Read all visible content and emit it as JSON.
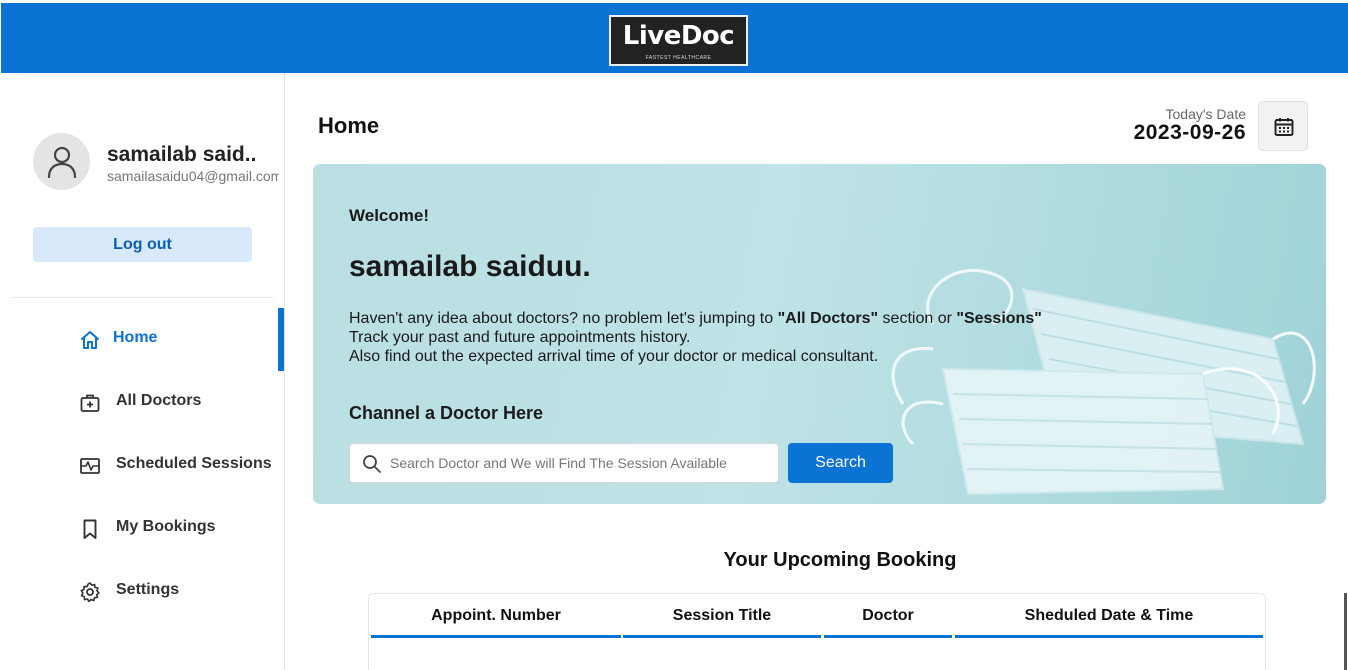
{
  "header": {
    "logo_text": "LiveDoc",
    "logo_tagline": "FASTEST HEALTHCARE"
  },
  "sidebar": {
    "user_name": "samailab said..",
    "user_email": "samailasaidu04@gmail.com",
    "logout_label": "Log out",
    "items": [
      {
        "label": "Home",
        "icon": "home-icon",
        "active": true
      },
      {
        "label": "All Doctors",
        "icon": "doctor-bag-icon",
        "active": false
      },
      {
        "label": "Scheduled Sessions",
        "icon": "pulse-schedule-icon",
        "active": false
      },
      {
        "label": "My Bookings",
        "icon": "bookmark-icon",
        "active": false
      },
      {
        "label": "Settings",
        "icon": "gear-icon",
        "active": false
      }
    ]
  },
  "main": {
    "title": "Home",
    "date_label": "Today's Date",
    "date_value": "2023-09-26",
    "banner": {
      "welcome": "Welcome!",
      "name": "samailab saiduu.",
      "line1_prefix": "Haven't any idea about doctors? no problem let's jumping to ",
      "line1_link1": "\"All Doctors\"",
      "line1_mid": " section or ",
      "line1_link2": "\"Sessions\"",
      "line2": "Track your past and future appointments history.",
      "line3": "Also find out the expected arrival time of your doctor or medical consultant.",
      "channel_title": "Channel a Doctor Here",
      "search_placeholder": "Search Doctor and We will Find The Session Available",
      "search_button": "Search"
    },
    "upcoming": {
      "title": "Your Upcoming Booking",
      "columns": [
        "Appoint. Number",
        "Session Title",
        "Doctor",
        "Sheduled Date & Time"
      ]
    }
  },
  "colors": {
    "primary": "#0a73d4",
    "banner_bg": "#b9dfe3",
    "logout_bg": "#d7e9fb"
  }
}
